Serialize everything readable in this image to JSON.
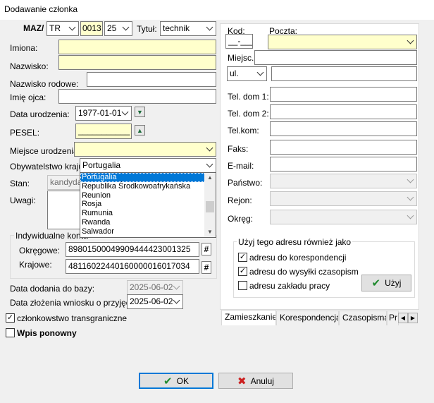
{
  "window": {
    "title": "Dodawanie członka"
  },
  "header": {
    "maz_label": "MAZ/",
    "region": "TR",
    "number": "0013",
    "suffix": "25",
    "title_label": "Tytuł:",
    "title_value": "technik"
  },
  "person": {
    "first_names_label": "Imiona:",
    "first_names": "",
    "surname_label": "Nazwisko:",
    "surname": "",
    "maiden_name_label": "Nazwisko rodowe:",
    "maiden_name": "",
    "father_name_label": "Imię ojca:",
    "father_name": "",
    "birth_date_label": "Data urodzenia:",
    "birth_date": "1977-01-01",
    "pesel_label": "PESEL:",
    "pesel": "___________",
    "birth_place_label": "Miejsce urodzenia:",
    "birth_place": "",
    "citizenship_label": "Obywatelstwo kraju:",
    "citizenship": "Portugalia",
    "status_label": "Stan:",
    "status": "kandydat",
    "notes_label": "Uwagi:"
  },
  "citizenship_dropdown": {
    "options": [
      "Portugalia",
      "Republika Środkowoafrykańska",
      "Reunion",
      "Rosja",
      "Rumunia",
      "Rwanda",
      "Salwador"
    ],
    "selected_index": 0
  },
  "accounts": {
    "group_label": "Indywidualne konta",
    "regional_label": "Okręgowe:",
    "regional": "89801500049909444423001325",
    "national_label": "Krajowe:",
    "national": "48116022440160000016017034"
  },
  "dates": {
    "added_label": "Data dodania do bazy:",
    "added": "2025-06-02",
    "application_label": "Data złożenia wniosku o przyjęcie:",
    "application": "2025-06-02"
  },
  "options": {
    "transborder_label": "członkowstwo transgraniczne",
    "transborder_checked": true,
    "re_entry_label": "Wpis ponowny",
    "re_entry_checked": false
  },
  "address": {
    "postal_code_label": "Kod:",
    "postal_code": "__-___",
    "post_office_label": "Poczta:",
    "post_office": "",
    "locality_label": "Miejsc.:",
    "locality": "",
    "street_type": "ul.",
    "street": "",
    "phone_home1_label": "Tel. dom 1:",
    "phone_home2_label": "Tel. dom 2:",
    "mobile_label": "Tel.kom:",
    "fax_label": "Faks:",
    "email_label": "E-mail:",
    "country_label": "Państwo:",
    "district_label": "Rejon:",
    "region_label": "Okręg:"
  },
  "use_address": {
    "group_label": "Użyj tego adresu również jako",
    "correspondence_label": "adresu do korespondencji",
    "correspondence_checked": true,
    "magazine_label": "adresu do wysyłki czasopism",
    "magazine_checked": true,
    "workplace_label": "adresu zakładu pracy",
    "workplace_checked": false,
    "apply_label": "Użyj"
  },
  "tabs": [
    "Zamieszkanie",
    "Korespondencja",
    "Czasopisma",
    "Pr"
  ],
  "footer": {
    "ok_label": "OK",
    "cancel_label": "Anuluj"
  },
  "icons": {
    "arrow_down": "arrow-down-icon",
    "arrow_up": "arrow-up-icon",
    "hash": "hash-icon",
    "checkmark": "checkmark-icon",
    "cross": "cross-icon"
  },
  "colors": {
    "highlight": "#0078d7",
    "required_field": "#ffffcc",
    "ok_check": "#1f8a2e",
    "cancel_x": "#cc1f1f"
  }
}
